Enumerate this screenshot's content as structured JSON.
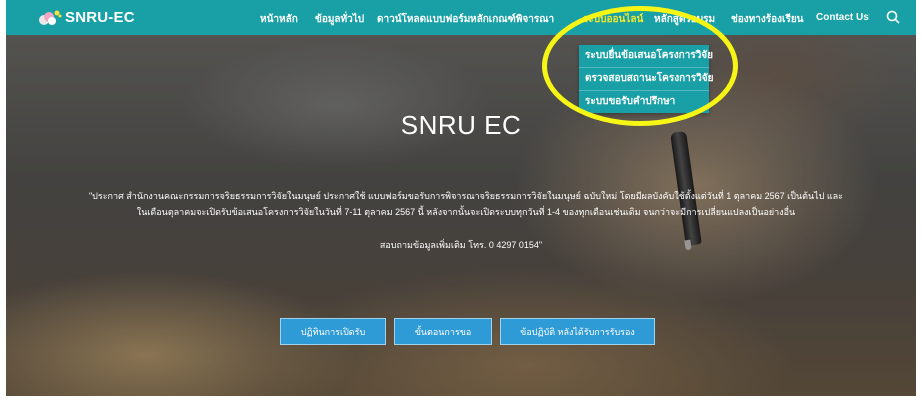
{
  "brand": {
    "name": "SNRU-EC",
    "logo_icon": "flower-logo-icon"
  },
  "nav": {
    "items": [
      {
        "label": "หน้าหลัก"
      },
      {
        "label": "ข้อมูลทั่วไป"
      },
      {
        "label": "ดาวน์โหลดแบบฟอร์ม"
      },
      {
        "label": "หลักเกณฑ์พิจารณา"
      },
      {
        "label": "ระบบออนไลน์",
        "active": true
      },
      {
        "label": "หลักสูตรอบรม"
      },
      {
        "label": "ช่องทางร้องเรียน"
      },
      {
        "label": "Contact Us"
      }
    ],
    "search_icon": "search-icon"
  },
  "dropdown": {
    "items": [
      {
        "label": "ระบบยื่นข้อเสนอโครงการวิจัย"
      },
      {
        "label": "ตรวจสอบสถานะโครงการวิจัย"
      },
      {
        "label": "ระบบขอรับคำปรึกษา"
      }
    ]
  },
  "hero": {
    "title": "SNRU EC",
    "announcement": "\"ประกาศ สำนักงานคณะกรรมการจริยธรรมการวิจัยในมนุษย์ ประกาศใช้ แบบฟอร์มขอรับการพิจารณาจริยธรรมการวิจัยในมนุษย์ ฉบับใหม่ โดยมีผลบังคับใช้ตั้งแต่วันที่ 1 ตุลาคม 2567 เป็นต้นไป และในเดือนตุลาคมจะเปิดรับข้อเสนอโครงการวิจัยในวันที่ 7-11 ตุลาคม 2567 นี้ หลังจากนั้นจะเปิดระบบทุกวันที่ 1-4 ของทุกเดือนเช่นเดิม จนกว่าจะมีการเปลี่ยนแปลงเป็นอย่างอื่น",
    "contact": "สอบถามข้อมูลเพิ่มเติม โทร. 0 4297 0154\""
  },
  "buttons": [
    {
      "label": "ปฏิทินการเปิดรับ"
    },
    {
      "label": "ขั้นตอนการขอ"
    },
    {
      "label": "ข้อปฏิบัติ หลังได้รับการรับรอง"
    }
  ],
  "colors": {
    "nav_bg": "#19a0a7",
    "active": "#f4ea2a",
    "button": "#2e9bd6",
    "highlight": "#f6f516"
  }
}
